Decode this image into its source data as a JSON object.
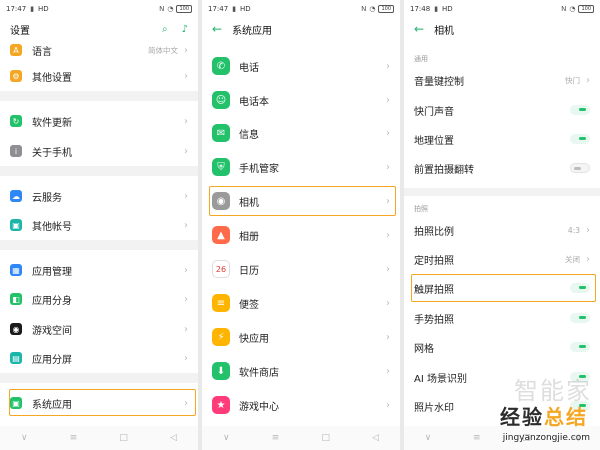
{
  "panel1": {
    "status": {
      "time": "17:47",
      "network": "HD",
      "battery": "100"
    },
    "title": "设置",
    "items": [
      {
        "label": "语言",
        "value": "简体中文",
        "color": "#f5a623",
        "icon": "language-icon",
        "glyph": "A"
      },
      {
        "label": "其他设置",
        "color": "#f5a623",
        "icon": "gear-icon",
        "glyph": "⚙"
      },
      {
        "label": "软件更新",
        "color": "#22c16a",
        "icon": "update-icon",
        "glyph": "↻"
      },
      {
        "label": "关于手机",
        "color": "#8e8e93",
        "icon": "info-icon",
        "glyph": "i"
      },
      {
        "label": "云服务",
        "color": "#2f86f6",
        "icon": "cloud-icon",
        "glyph": "☁"
      },
      {
        "label": "其他帐号",
        "color": "#1cb5a9",
        "icon": "account-icon",
        "glyph": "▣"
      },
      {
        "label": "应用管理",
        "color": "#2f86f6",
        "icon": "apps-icon",
        "glyph": "▦"
      },
      {
        "label": "应用分身",
        "color": "#22c16a",
        "icon": "clone-icon",
        "glyph": "◧"
      },
      {
        "label": "游戏空间",
        "color": "#1a1a1a",
        "icon": "game-space-icon",
        "glyph": "◉"
      },
      {
        "label": "应用分屏",
        "color": "#1cb5a9",
        "icon": "split-screen-icon",
        "glyph": "▤"
      },
      {
        "label": "系统应用",
        "color": "#22c16a",
        "icon": "system-apps-icon",
        "glyph": "▣"
      }
    ]
  },
  "panel2": {
    "status": {
      "time": "17:47",
      "network": "HD",
      "battery": "100"
    },
    "title": "系统应用",
    "items": [
      {
        "label": "电话",
        "color": "#22c16a",
        "icon": "phone-icon",
        "glyph": "✆"
      },
      {
        "label": "电话本",
        "color": "#22c16a",
        "icon": "contacts-icon",
        "glyph": "☺"
      },
      {
        "label": "信息",
        "color": "#22c16a",
        "icon": "message-icon",
        "glyph": "✉"
      },
      {
        "label": "手机管家",
        "color": "#22c16a",
        "icon": "phone-manager-icon",
        "glyph": "⛨"
      },
      {
        "label": "相机",
        "color": "#9a9a9a",
        "icon": "camera-icon",
        "glyph": "◉"
      },
      {
        "label": "相册",
        "color": "#ff6b4a",
        "icon": "gallery-icon",
        "glyph": "▲"
      },
      {
        "label": "日历",
        "color": "#ffffff",
        "icon": "calendar-icon",
        "glyph": "26"
      },
      {
        "label": "便签",
        "color": "#ffb400",
        "icon": "notes-icon",
        "glyph": "≡"
      },
      {
        "label": "快应用",
        "color": "#ffb400",
        "icon": "quick-app-icon",
        "glyph": "⚡"
      },
      {
        "label": "软件商店",
        "color": "#22c16a",
        "icon": "app-store-icon",
        "glyph": "⬇"
      },
      {
        "label": "游戏中心",
        "color": "#ff3b7a",
        "icon": "game-center-icon",
        "glyph": "★"
      }
    ]
  },
  "panel3": {
    "status": {
      "time": "17:48",
      "network": "HD",
      "battery": "100"
    },
    "title": "相机",
    "section1": "通用",
    "section2": "拍照",
    "items": [
      {
        "label": "音量键控制",
        "value": "快门",
        "kind": "chevron"
      },
      {
        "label": "快门声音",
        "kind": "toggle",
        "on": true
      },
      {
        "label": "地理位置",
        "kind": "toggle",
        "on": true
      },
      {
        "label": "前置拍摄翻转",
        "kind": "toggle",
        "on": false
      },
      {
        "label": "拍照比例",
        "value": "4:3",
        "kind": "chevron"
      },
      {
        "label": "定时拍照",
        "value": "关闭",
        "kind": "chevron"
      },
      {
        "label": "触屏拍照",
        "kind": "toggle",
        "on": true
      },
      {
        "label": "手势拍照",
        "kind": "toggle",
        "on": true
      },
      {
        "label": "网格",
        "kind": "toggle",
        "on": true
      },
      {
        "label": "AI 场景识别",
        "kind": "toggle",
        "on": true
      },
      {
        "label": "照片水印",
        "kind": "toggle",
        "on": true
      }
    ],
    "watermark": {
      "faint": "智能家",
      "brand_a": "经验",
      "brand_b": "总结",
      "url": "jingyanzongjie.com"
    }
  },
  "colors": {
    "accent": "#22c16a",
    "highlight": "#f5a623"
  }
}
